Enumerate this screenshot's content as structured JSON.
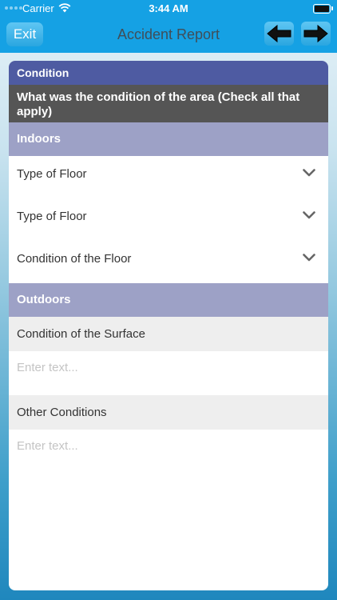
{
  "status_bar": {
    "carrier": "Carrier",
    "time": "3:44 AM"
  },
  "nav": {
    "exit_label": "Exit",
    "title": "Accident Report"
  },
  "card": {
    "section_title": "Condition",
    "question": "What was the condition of the area (Check all that apply)",
    "indoors": {
      "title": "Indoors",
      "items": [
        {
          "label": "Type of Floor"
        },
        {
          "label": "Type of Floor"
        },
        {
          "label": "Condition of the Floor"
        }
      ]
    },
    "outdoors": {
      "title": "Outdoors",
      "fields": [
        {
          "label": "Condition of the Surface",
          "placeholder": "Enter text...",
          "value": ""
        },
        {
          "label": "Other Conditions",
          "placeholder": "Enter text...",
          "value": ""
        }
      ]
    }
  },
  "icons": {
    "chevron": "chevron-down-icon",
    "prev": "arrow-left-icon",
    "next": "arrow-right-icon",
    "wifi": "wifi-icon",
    "battery": "battery-icon"
  },
  "colors": {
    "nav_bar": "#15a1e4",
    "section_header": "#4e5ba2",
    "question_bg": "#555555",
    "group_header": "#9da1c6",
    "field_label_bg": "#eeeeee"
  }
}
